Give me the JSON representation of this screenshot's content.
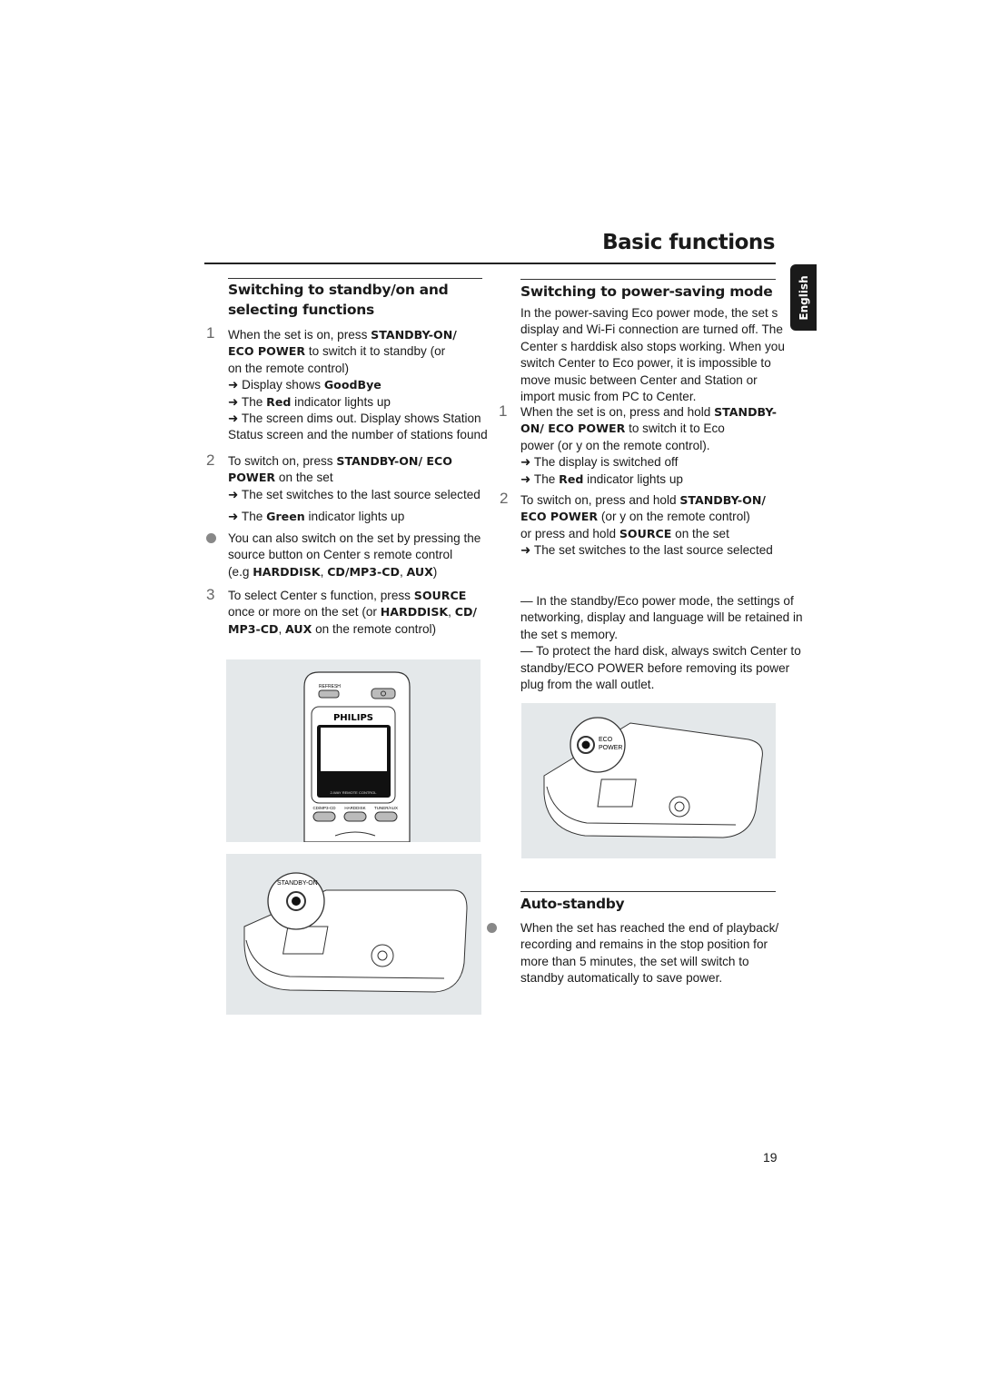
{
  "header": {
    "title": "Basic functions",
    "language_tab": "English"
  },
  "left": {
    "heading_1": "Switching to standby/on and",
    "heading_2": "selecting functions",
    "step1_num": "1",
    "step1": [
      [
        "When the set is on, press ",
        {
          "b": "STANDBY-ON/"
        }
      ],
      [
        {
          "b": "ECO POWER"
        },
        " to switch it to standby (or"
      ],
      [
        "on the remote control)"
      ],
      [
        "➜ Display shows ",
        {
          "b": "GoodBye"
        }
      ],
      [
        "➜ The ",
        {
          "b": "Red"
        },
        " indicator lights up"
      ],
      [
        "➜ The screen dims out. Display shows Station"
      ],
      [
        "Status screen and the number of stations found"
      ]
    ],
    "step2_num": "2",
    "step2": [
      [
        "To switch on, press ",
        {
          "b": "STANDBY-ON/ ECO"
        }
      ],
      [
        {
          "b": "POWER"
        },
        " on the set"
      ],
      [
        "➜ The set switches to the last source selected"
      ]
    ],
    "step2b": [
      [
        "➜ The ",
        {
          "b": "Green"
        },
        " indicator lights up"
      ]
    ],
    "bullet": [
      [
        "You can also switch on the set by pressing the"
      ],
      [
        "source button on Center s remote control"
      ],
      [
        "(e.g ",
        {
          "b": "HARDDISK"
        },
        ", ",
        {
          "b": "CD/MP3-CD"
        },
        ", ",
        {
          "b": "AUX"
        },
        ")"
      ]
    ],
    "step3_num": "3",
    "step3": [
      [
        "To select Center s function, press ",
        {
          "b": "SOURCE"
        }
      ],
      [
        "once or more on the set (or ",
        {
          "b": "HARDDISK"
        },
        ", ",
        {
          "b": "CD/"
        }
      ],
      [
        {
          "b": "MP3-CD"
        },
        ", ",
        {
          "b": "AUX"
        },
        " on the remote control)"
      ]
    ],
    "remote_labels": {
      "refresh": "REFRESH",
      "brand": "PHILIPS",
      "caption": "2-WAY REMOTE CONTROL",
      "btn1": "CD/MP3-CD",
      "btn2": "HARDDISK",
      "btn3": "TUNER/AUX"
    },
    "device_label": "STANDBY-ON"
  },
  "right": {
    "heading": "Switching to power-saving mode",
    "intro": [
      [
        "In the power-saving Eco power mode, the set s"
      ],
      [
        "display and Wi-Fi connection are turned off.  The"
      ],
      [
        "Center s harddisk also stops working.  When you"
      ],
      [
        "switch Center to Eco power, it is impossible to"
      ],
      [
        "move music between Center and Station or"
      ],
      [
        "import music from PC to Center."
      ]
    ],
    "step1_num": "1",
    "step1": [
      [
        "When the set is on, press and hold ",
        {
          "b": "STANDBY-"
        }
      ],
      [
        {
          "b": "ON/ ECO POWER"
        },
        "  to switch it to Eco"
      ],
      [
        "power (or y  on the remote control)."
      ],
      [
        "➜ The display is switched off"
      ],
      [
        "➜ The ",
        {
          "b": "Red"
        },
        " indicator lights up"
      ]
    ],
    "step2_num": "2",
    "step2": [
      [
        "To switch on, press and hold ",
        {
          "b": "STANDBY-ON/"
        }
      ],
      [
        {
          "b": "ECO POWER"
        },
        " (or y   on the remote control)"
      ],
      [
        "or press and hold ",
        {
          "b": "SOURCE"
        },
        " on the set"
      ],
      [
        "➜ The set switches to the last source selected"
      ]
    ],
    "notes": [
      [
        "— In the standby/Eco power mode, the settings of"
      ],
      [
        "networking, display and language will be retained in"
      ],
      [
        "the set s memory."
      ],
      [
        "— To protect the hard disk, always switch Center to"
      ],
      [
        "standby/ECO POWER before removing its power"
      ],
      [
        "plug from the wall outlet."
      ]
    ],
    "device_label_1": "ECO",
    "device_label_2": "POWER",
    "auto_heading": "Auto-standby",
    "auto": [
      [
        "When the set has reached the end of playback/"
      ],
      [
        "recording and remains in the stop position for"
      ],
      [
        "more than 5 minutes, the set will switch to"
      ],
      [
        "standby automatically to save power."
      ]
    ]
  },
  "footer": {
    "page_number": "19"
  }
}
